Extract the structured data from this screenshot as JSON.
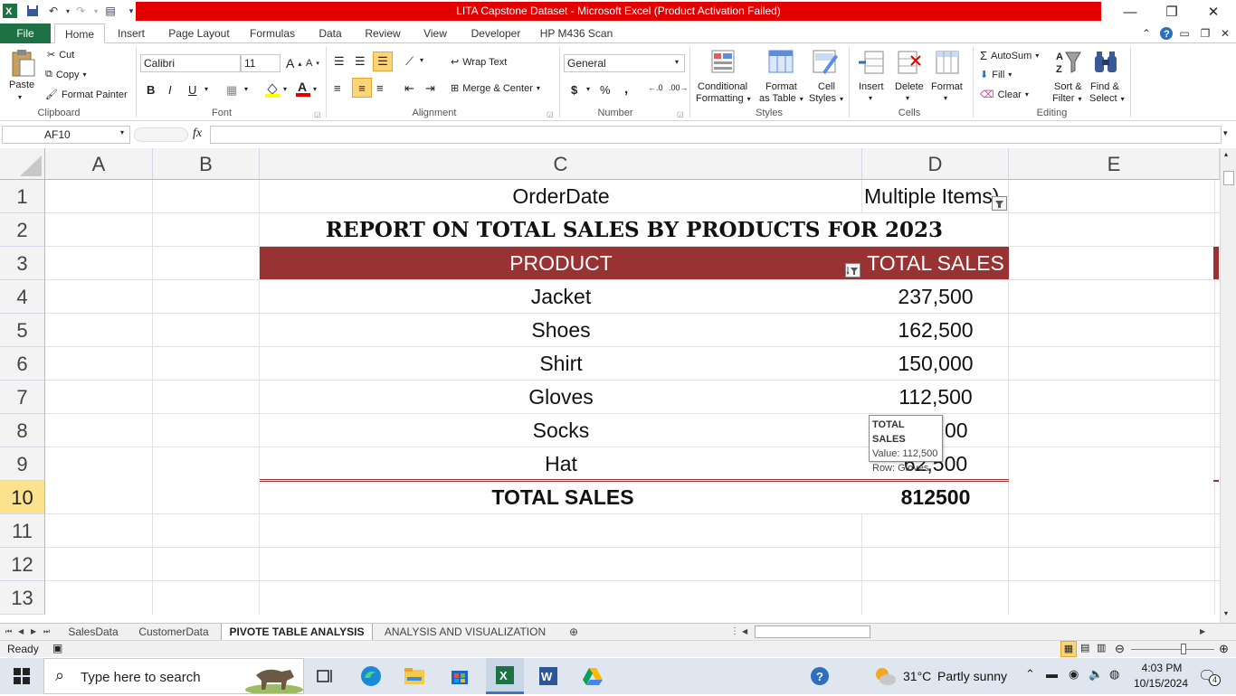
{
  "window": {
    "title": "LITA Capstone Dataset  -  Microsoft Excel (Product Activation Failed)"
  },
  "tabs": [
    "File",
    "Home",
    "Insert",
    "Page Layout",
    "Formulas",
    "Data",
    "Review",
    "View",
    "Developer",
    "HP M436 Scan"
  ],
  "ribbon": {
    "clipboard": {
      "paste": "Paste",
      "cut": "Cut",
      "copy": "Copy",
      "format_painter": "Format Painter",
      "label": "Clipboard"
    },
    "font": {
      "name": "Calibri",
      "size": "11",
      "bold": "B",
      "italic": "I",
      "underline": "U",
      "label": "Font"
    },
    "alignment": {
      "wrap_text": "Wrap Text",
      "merge_center": "Merge & Center",
      "label": "Alignment"
    },
    "number": {
      "format": "General",
      "currency": "$",
      "percent": "%",
      "comma": ",",
      "label": "Number"
    },
    "styles": {
      "conditional": "Conditional",
      "conditional2": "Formatting",
      "format_table": "Format",
      "format_table2": "as Table",
      "cell_styles": "Cell",
      "cell_styles2": "Styles",
      "label": "Styles"
    },
    "cells": {
      "insert": "Insert",
      "delete": "Delete",
      "format": "Format",
      "label": "Cells"
    },
    "editing": {
      "autosum": "AutoSum",
      "fill": "Fill",
      "clear": "Clear",
      "sort": "Sort &",
      "sort2": "Filter",
      "find": "Find &",
      "find2": "Select",
      "label": "Editing"
    }
  },
  "formula_bar": {
    "name_box": "AF10",
    "fx": "fx",
    "value": ""
  },
  "columns": [
    "A",
    "B",
    "C",
    "D",
    "E"
  ],
  "rows": [
    "1",
    "2",
    "3",
    "4",
    "5",
    "6",
    "7",
    "8",
    "9",
    "10",
    "11",
    "12",
    "13"
  ],
  "sheet": {
    "filter_label": "OrderDate",
    "filter_value": "Multiple Items)",
    "report_title": "REPORT ON  TOTAL SALES BY PRODUCTS FOR 2023",
    "header_product": "PRODUCT",
    "header_sales": "TOTAL SALES",
    "items": [
      {
        "product": "Jacket",
        "sales": "237,500"
      },
      {
        "product": "Shoes",
        "sales": "162,500"
      },
      {
        "product": "Shirt",
        "sales": "150,000"
      },
      {
        "product": "Gloves",
        "sales": "112,500"
      },
      {
        "product": "Socks",
        "sales": "00"
      },
      {
        "product": "Hat",
        "sales": "62,500"
      }
    ],
    "total_label": "TOTAL SALES",
    "total_value": "812500"
  },
  "tooltip": {
    "title": "TOTAL SALES",
    "value": "Value: 112,500",
    "row": "Row: Gloves"
  },
  "sheet_tabs": [
    "SalesData",
    "CustomerData",
    "PIVOTE TABLE ANALYSIS",
    "ANALYSIS AND VISUALIZATION"
  ],
  "active_sheet": "PIVOTE TABLE ANALYSIS",
  "status": "Ready",
  "taskbar": {
    "search_placeholder": "Type here to search",
    "weather_temp": "31°C",
    "weather_text": "Partly sunny",
    "time": "4:03 PM",
    "date": "10/15/2024",
    "notifications": "4"
  },
  "colors": {
    "header_fill": "#993333",
    "excel_green": "#1e7145",
    "title_red": "#e30000",
    "selected_row": "#fce28c"
  }
}
